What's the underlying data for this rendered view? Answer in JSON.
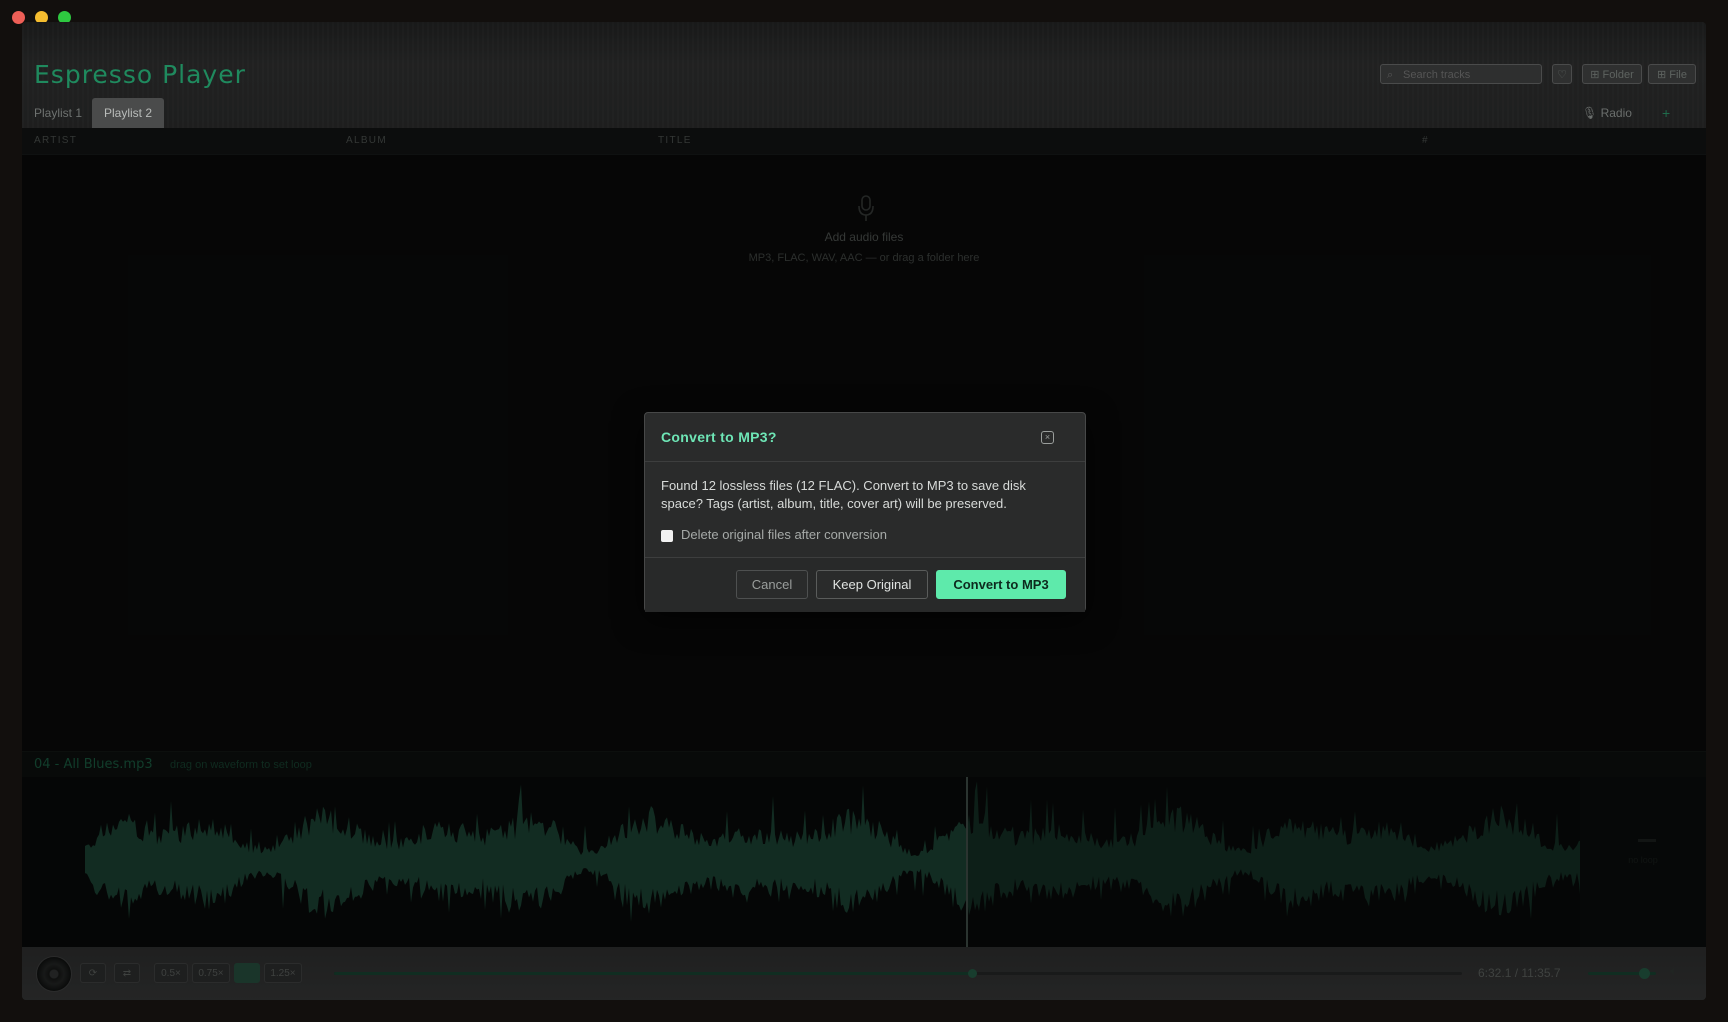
{
  "app": {
    "title": "Espresso Player",
    "search_placeholder": "Search tracks",
    "buttons": {
      "heart": "♡",
      "folder": "Folder",
      "file": "File"
    }
  },
  "tabs": [
    {
      "label": "Playlist 1",
      "active": false
    },
    {
      "label": "Playlist 2",
      "active": true
    }
  ],
  "radio_label": "Radio",
  "add_tab_label": "+",
  "columns": [
    "ARTIST",
    "ALBUM",
    "TITLE",
    "#"
  ],
  "empty_state": {
    "title": "Add audio files",
    "subtitle": "MP3, FLAC, WAV, AAC — or drag a folder here"
  },
  "track": {
    "name": "04 - All Blues.mp3",
    "hint": "drag on waveform to set loop",
    "no_loop_label": "no loop",
    "played_fraction": 0.566
  },
  "transport": {
    "repeat_icon": "⟳",
    "shuffle_icon": "⇄",
    "speeds": [
      "0.5×",
      "0.75×",
      "1×",
      "1.25×"
    ],
    "active_speed_index": 2,
    "progress_fraction": 0.566,
    "time": "6:32.1 / 11:35.7",
    "volume_fraction": 0.82
  },
  "modal": {
    "title": "Convert to MP3?",
    "body": "Found 12 lossless files (12 FLAC). Convert to MP3 to save disk space? Tags (artist, album, title, cover art) will be preserved.",
    "checkbox_label": "Delete original files after conversion",
    "checkbox_checked": false,
    "cancel_label": "Cancel",
    "keep_label": "Keep Original",
    "convert_label": "Convert to MP3"
  },
  "colors": {
    "accent": "#5eeaab",
    "wave_played": "#1f4d3b",
    "wave_unplayed": "#17362a"
  }
}
